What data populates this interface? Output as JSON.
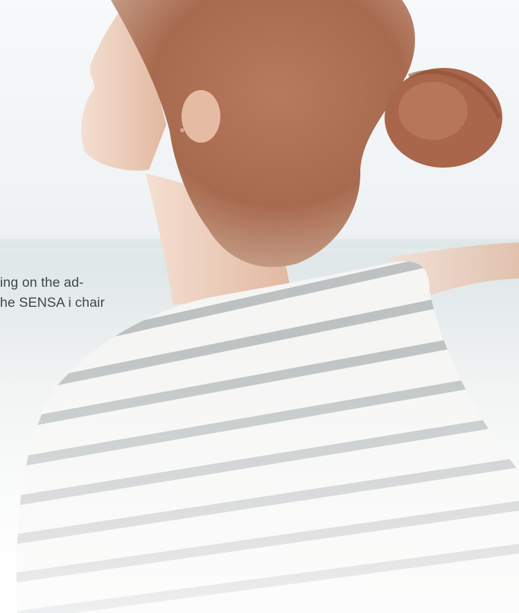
{
  "caption": {
    "line1": "ing on the ad-",
    "line2": "he SENSA i chair"
  },
  "image": {
    "subject": "woman-with-outstretched-arms-on-beach",
    "colors": {
      "sky": "#eef2f4",
      "sea": "#dfe7e8",
      "hair": "#a86a4f",
      "skin": "#e9c4ae",
      "shirt": "#f5f5f4",
      "stripe": "#8f9599",
      "text": "#3f4648"
    }
  }
}
